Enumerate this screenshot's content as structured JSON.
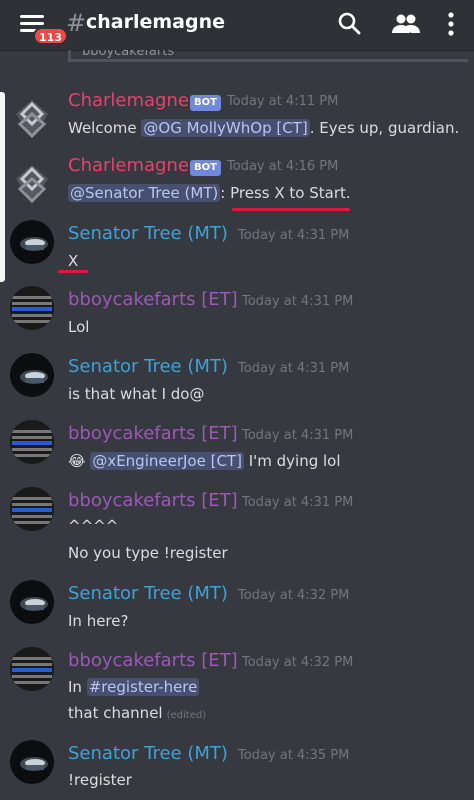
{
  "header": {
    "channel": "charlemagne",
    "hash": "#",
    "badge": "113",
    "icons": [
      "menu-icon",
      "search-icon",
      "members-icon",
      "more-icon"
    ]
  },
  "previous_message_snippet": "bboycakefarts",
  "messages": [
    {
      "author": "Charlemagne",
      "bot": "BOT",
      "time": "Today at 4:11 PM",
      "pre": "Welcome ",
      "mention": "@OG MollyWhOp [CT]",
      "post": ". Eyes up, guardian."
    },
    {
      "author": "Charlemagne",
      "bot": "BOT",
      "time": "Today at 4:16 PM",
      "mention": "@Senator Tree (MT)",
      "post": ": Press X to Start."
    },
    {
      "author": "Senator Tree (MT)",
      "time": "Today at 4:31 PM",
      "text": "X"
    },
    {
      "author": "bboycakefarts [ET]",
      "time": "Today at 4:31 PM",
      "text": "Lol"
    },
    {
      "author": "Senator Tree (MT)",
      "time": "Today at 4:31 PM",
      "text": "is that what I do@"
    },
    {
      "author": "bboycakefarts [ET]",
      "time": "Today at 4:31 PM",
      "emoji": "😂",
      "mention": "@xEngineerJoe [CT]",
      "post": " I'm dying lol"
    },
    {
      "author": "bboycakefarts [ET]",
      "time": "Today at 4:31 PM",
      "text": "^^^^",
      "text2": "No you type !register"
    },
    {
      "author": "Senator Tree (MT)",
      "time": "Today at 4:32 PM",
      "text": "In here?"
    },
    {
      "author": "bboycakefarts [ET]",
      "time": "Today at 4:32 PM",
      "pre": "In  ",
      "mention": "#register-here",
      "text2": "that channel",
      "edited": "(edited)"
    },
    {
      "author": "Senator Tree (MT)",
      "time": "Today at 4:35 PM",
      "text": "!register"
    }
  ],
  "colors": {
    "background": "#36393f",
    "header": "#2f3136",
    "bot_name": "#e9416b",
    "mt_name": "#3fa2d8",
    "et_name": "#9b59b6",
    "annotation": "#e0193a",
    "badge": "#f04747"
  }
}
